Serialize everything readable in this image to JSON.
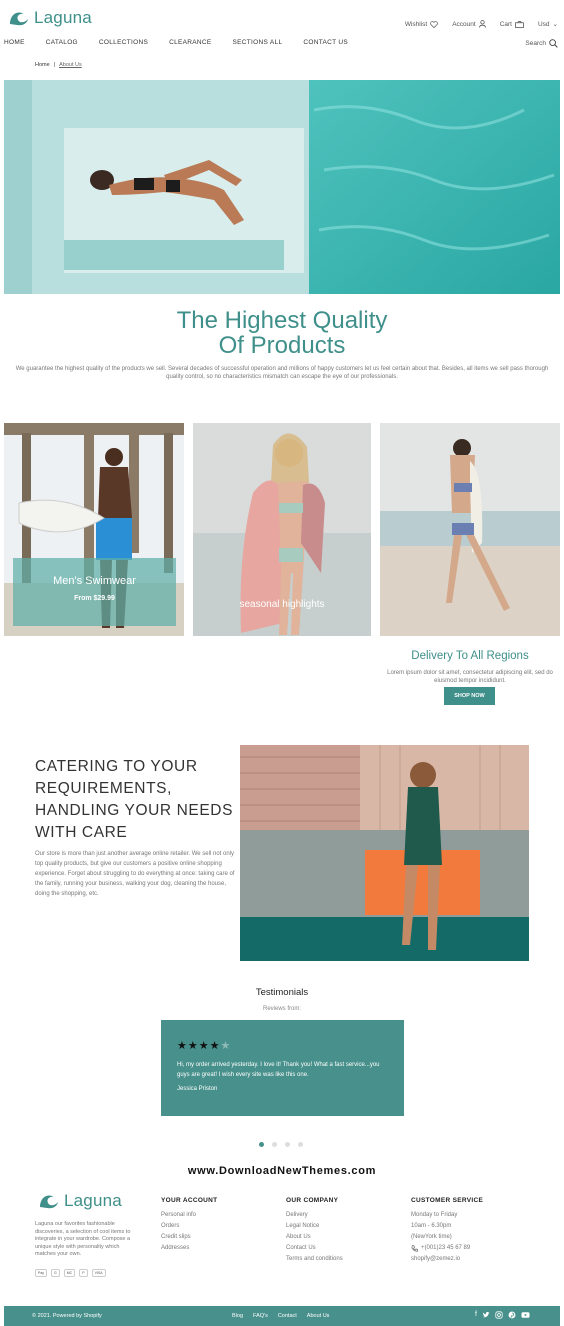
{
  "brand": {
    "name": "Laguna",
    "accent": "#3f8f8a"
  },
  "header": {
    "wishlist": "Wishlist",
    "account": "Account",
    "cart": "Cart",
    "currency": "Usd"
  },
  "nav": [
    "HOME",
    "CATALOG",
    "COLLECTIONS",
    "CLEARANCE",
    "SECTIONS ALL",
    "CONTACT US"
  ],
  "search_label": "Search",
  "breadcrumb": {
    "home": "Home",
    "current": "About Us"
  },
  "hero": {
    "title_line1": "The Highest Quality",
    "title_line2": "Of Products",
    "text": "We guarantee the highest quality of the products we sell. Several decades of successful operation and millions of happy customers let us feel certain about that. Besides, all items we sell pass thorough quality control, so no characteristics mismatch can escape the eye of our professionals."
  },
  "cards": [
    {
      "title": "Men's Swimwear",
      "price": "From $29.99"
    },
    {
      "title": "seasonal highlights"
    },
    {
      "title": "Delivery To All Regions",
      "text": "Lorem ipsum dolor sit amet, consectetur adipiscing elit, sed do eiusmod tempor incididunt.",
      "button": "SHOP NOW"
    }
  ],
  "catering": {
    "heading": "CATERING TO YOUR REQUIREMENTS, HANDLING YOUR NEEDS WITH CARE",
    "text": "Our store is more than just another average online retailer. We sell not only top quality products, but give our customers a positive online shopping experience. Forget about struggling to do everything at once: taking care of the family, running your business, walking your dog, cleaning the house, doing the shopping, etc."
  },
  "testimonials": {
    "title": "Testimonials",
    "subtitle": "Reviews from:",
    "rating": 4,
    "max_rating": 5,
    "quote": "Hi, my order arrived yesterday. I love it! Thank you! What a fast service...you guys are great! I wish every site was like this one.",
    "author": "Jessica Priston"
  },
  "watermark": "www.DownloadNewThemes.com",
  "footer": {
    "about": "Laguna our favorites fashionable discoveries, a selection of cool items to integrate in your wardrobe. Compose a unique style with personality which matches your own.",
    "payments": [
      "Pay",
      "G",
      "MC",
      "P",
      "VISA"
    ],
    "your_account": {
      "title": "YOUR ACCOUNT",
      "items": [
        "Personal info",
        "Orders",
        "Credit slips",
        "Addresses"
      ]
    },
    "our_company": {
      "title": "OUR COMPANY",
      "items": [
        "Delivery",
        "Legal Notice",
        "About Us",
        "Contact Us",
        "Terms and conditions"
      ]
    },
    "customer_service": {
      "title": "CUSTOMER SERVICE",
      "items": [
        "Monday to Friday",
        "10am - 6.30pm",
        "(NewYork time)",
        "+(001)23 45 67 89",
        "shopify@zemez.io"
      ]
    },
    "copyright": "© 2021. Powered by Shopify",
    "links": [
      "Blog",
      "FAQ's",
      "Contact",
      "About Us"
    ],
    "social_icons": [
      "facebook-icon",
      "twitter-icon",
      "instagram-icon",
      "pinterest-icon",
      "youtube-icon"
    ]
  }
}
